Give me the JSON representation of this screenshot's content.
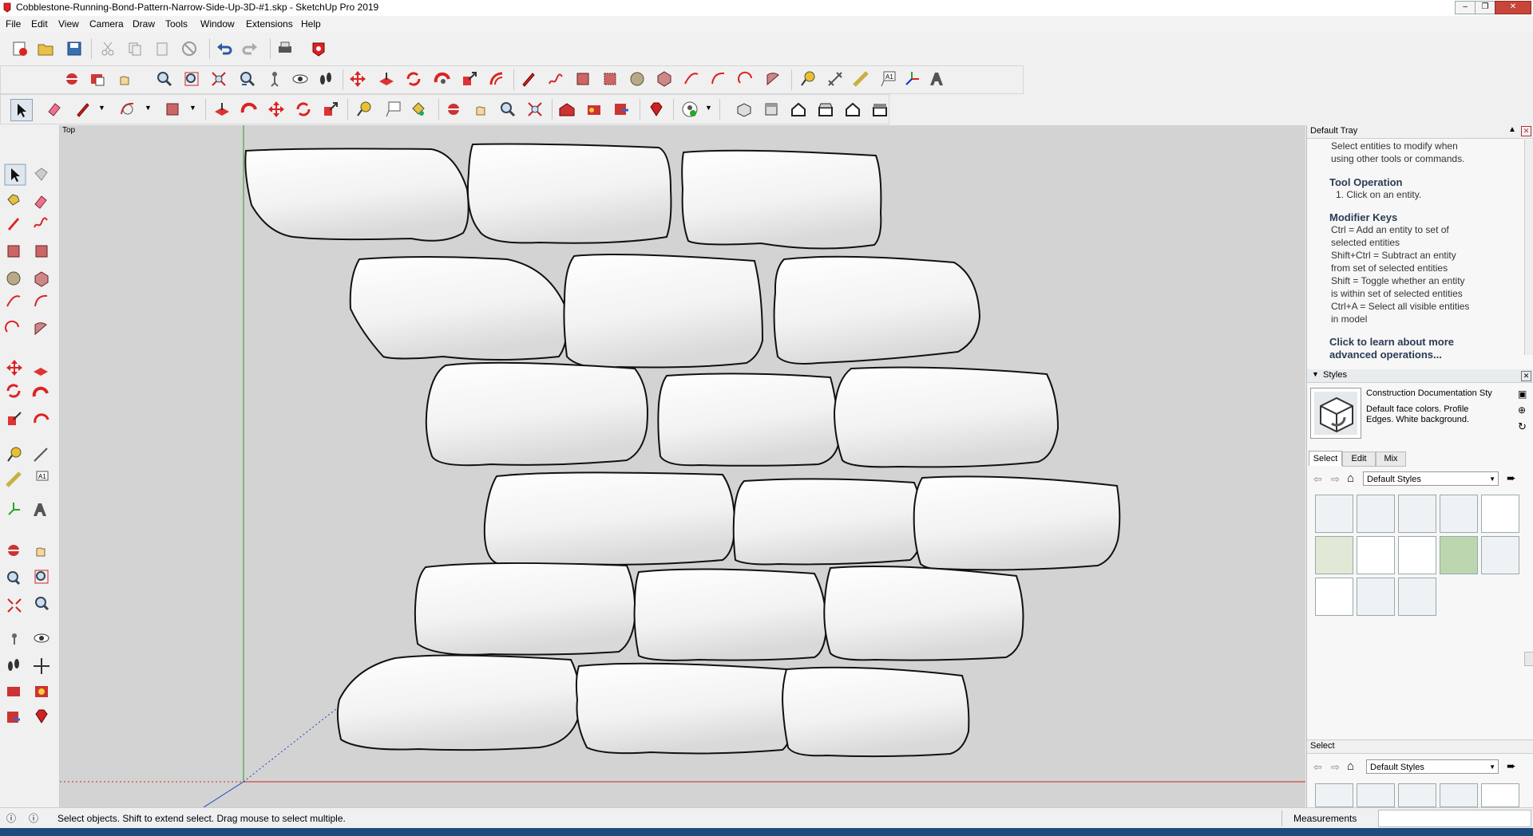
{
  "window": {
    "title": "Cobblestone-Running-Bond-Pattern-Narrow-Side-Up-3D-#1.skp - SketchUp Pro 2019"
  },
  "menu": [
    "File",
    "Edit",
    "View",
    "Camera",
    "Draw",
    "Tools",
    "Window",
    "Extensions",
    "Help"
  ],
  "viewport": {
    "view_label": "Top",
    "axis_colors": {
      "red": "#d02020",
      "green": "#20a020",
      "blue": "#2040c0"
    }
  },
  "tray": {
    "title": "Default Tray",
    "instructor": {
      "intro": [
        "Select entities to modify when",
        "using other tools or commands."
      ],
      "tool_operation_heading": "Tool Operation",
      "tool_operation_steps": [
        "1. Click on an entity."
      ],
      "modifier_heading": "Modifier Keys",
      "modifier_lines": [
        "Ctrl = Add an entity to set of",
        "selected entities",
        "Shift+Ctrl = Subtract an entity",
        "from set of selected entities",
        "Shift = Toggle whether an entity",
        "is within set of selected entities",
        "Ctrl+A = Select all visible entities",
        "in model"
      ],
      "learn_more": [
        "Click to learn about more",
        "advanced operations..."
      ]
    },
    "styles": {
      "heading": "Styles",
      "style_name": "Construction Documentation Sty",
      "style_desc": [
        "Default face colors. Profile",
        "Edges. White background."
      ],
      "tabs": [
        "Select",
        "Edit",
        "Mix"
      ],
      "library": "Default Styles"
    },
    "lower_select": {
      "heading": "Select",
      "library": "Default Styles"
    }
  },
  "status": {
    "message": "Select objects. Shift to extend select. Drag mouse to select multiple.",
    "measurements_label": "Measurements"
  }
}
